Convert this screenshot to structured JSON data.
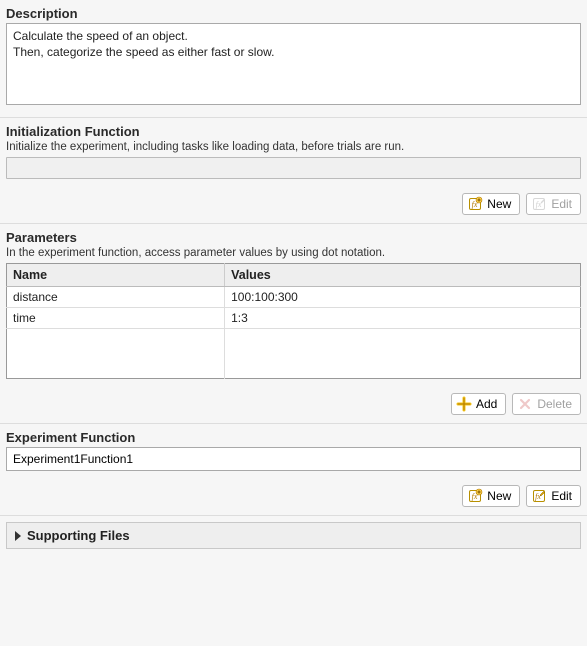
{
  "description": {
    "title": "Description",
    "value": "Calculate the speed of an object.\nThen, categorize the speed as either fast or slow."
  },
  "initFn": {
    "title": "Initialization Function",
    "help": "Initialize the experiment, including tasks like loading data, before trials are run.",
    "value": "",
    "buttons": {
      "new": "New",
      "edit": "Edit"
    }
  },
  "params": {
    "title": "Parameters",
    "help": "In the experiment function, access parameter values by using dot notation.",
    "columns": {
      "name": "Name",
      "values": "Values"
    },
    "rows": [
      {
        "name": "distance",
        "values": "100:100:300"
      },
      {
        "name": "time",
        "values": "1:3"
      }
    ],
    "buttons": {
      "add": "Add",
      "delete": "Delete"
    }
  },
  "expFn": {
    "title": "Experiment Function",
    "value": "Experiment1Function1",
    "buttons": {
      "new": "New",
      "edit": "Edit"
    }
  },
  "supporting": {
    "title": "Supporting Files"
  }
}
